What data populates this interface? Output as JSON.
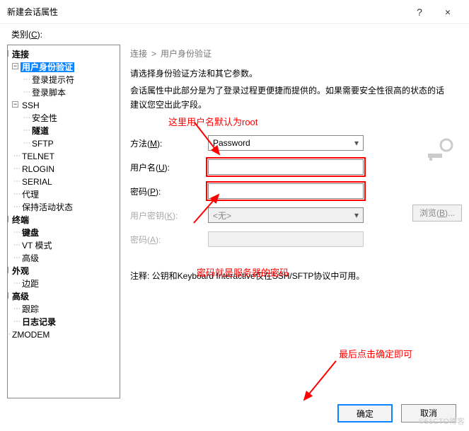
{
  "window": {
    "title": "新建会话属性",
    "help": "?",
    "close": "×"
  },
  "category_label_pre": "类别(",
  "category_label_key": "C",
  "category_label_post": "):",
  "tree": {
    "conn": "连接",
    "userauth": "用户身份验证",
    "loginprompt": "登录提示符",
    "loginscript": "登录脚本",
    "ssh": "SSH",
    "security": "安全性",
    "tunnel": "隧道",
    "sftp": "SFTP",
    "telnet": "TELNET",
    "rlogin": "RLOGIN",
    "serial": "SERIAL",
    "proxy": "代理",
    "keepalive": "保持活动状态",
    "terminal": "终端",
    "keyboard": "键盘",
    "vtmode": "VT 模式",
    "tadv": "高级",
    "appearance": "外观",
    "margin": "边距",
    "advanced": "高级",
    "trace": "跟踪",
    "log": "日志记录",
    "zmodem": "ZMODEM"
  },
  "breadcrumb": {
    "a": "连接",
    "sep": ">",
    "b": "用户身份验证"
  },
  "desc1": "请选择身份验证方法和其它参数。",
  "desc2": "会话属性中此部分是为了登录过程更便捷而提供的。如果需要安全性很高的状态的话建议您空出此字段。",
  "ann1": "这里用户名默认为root",
  "ann2": "密码就是服务器的密码",
  "ann3": "最后点击确定即可",
  "form": {
    "method_label_pre": "方法(",
    "method_key": "M",
    "method_label_post": "):",
    "method_value": "Password",
    "user_label_pre": "用户名(",
    "user_key": "U",
    "user_label_post": "):",
    "user_value": "",
    "pwd_label_pre": "密码(",
    "pwd_key": "P",
    "pwd_label_post": "):",
    "pwd_value": "",
    "ukey_label_pre": "用户密钥(",
    "ukey_key": "K",
    "ukey_label_post": "):",
    "ukey_value": "<无>",
    "pwd2_label_pre": "密码(",
    "pwd2_key": "A",
    "pwd2_label_post": "):",
    "pwd2_value": "",
    "browse_pre": "浏览(",
    "browse_key": "B",
    "browse_post": ")..."
  },
  "note": "注释: 公钥和Keyboard Interactive仅在SSH/SFTP协议中可用。",
  "buttons": {
    "ok": "确定",
    "cancel": "取消"
  },
  "watermark": "©51CTO博客"
}
